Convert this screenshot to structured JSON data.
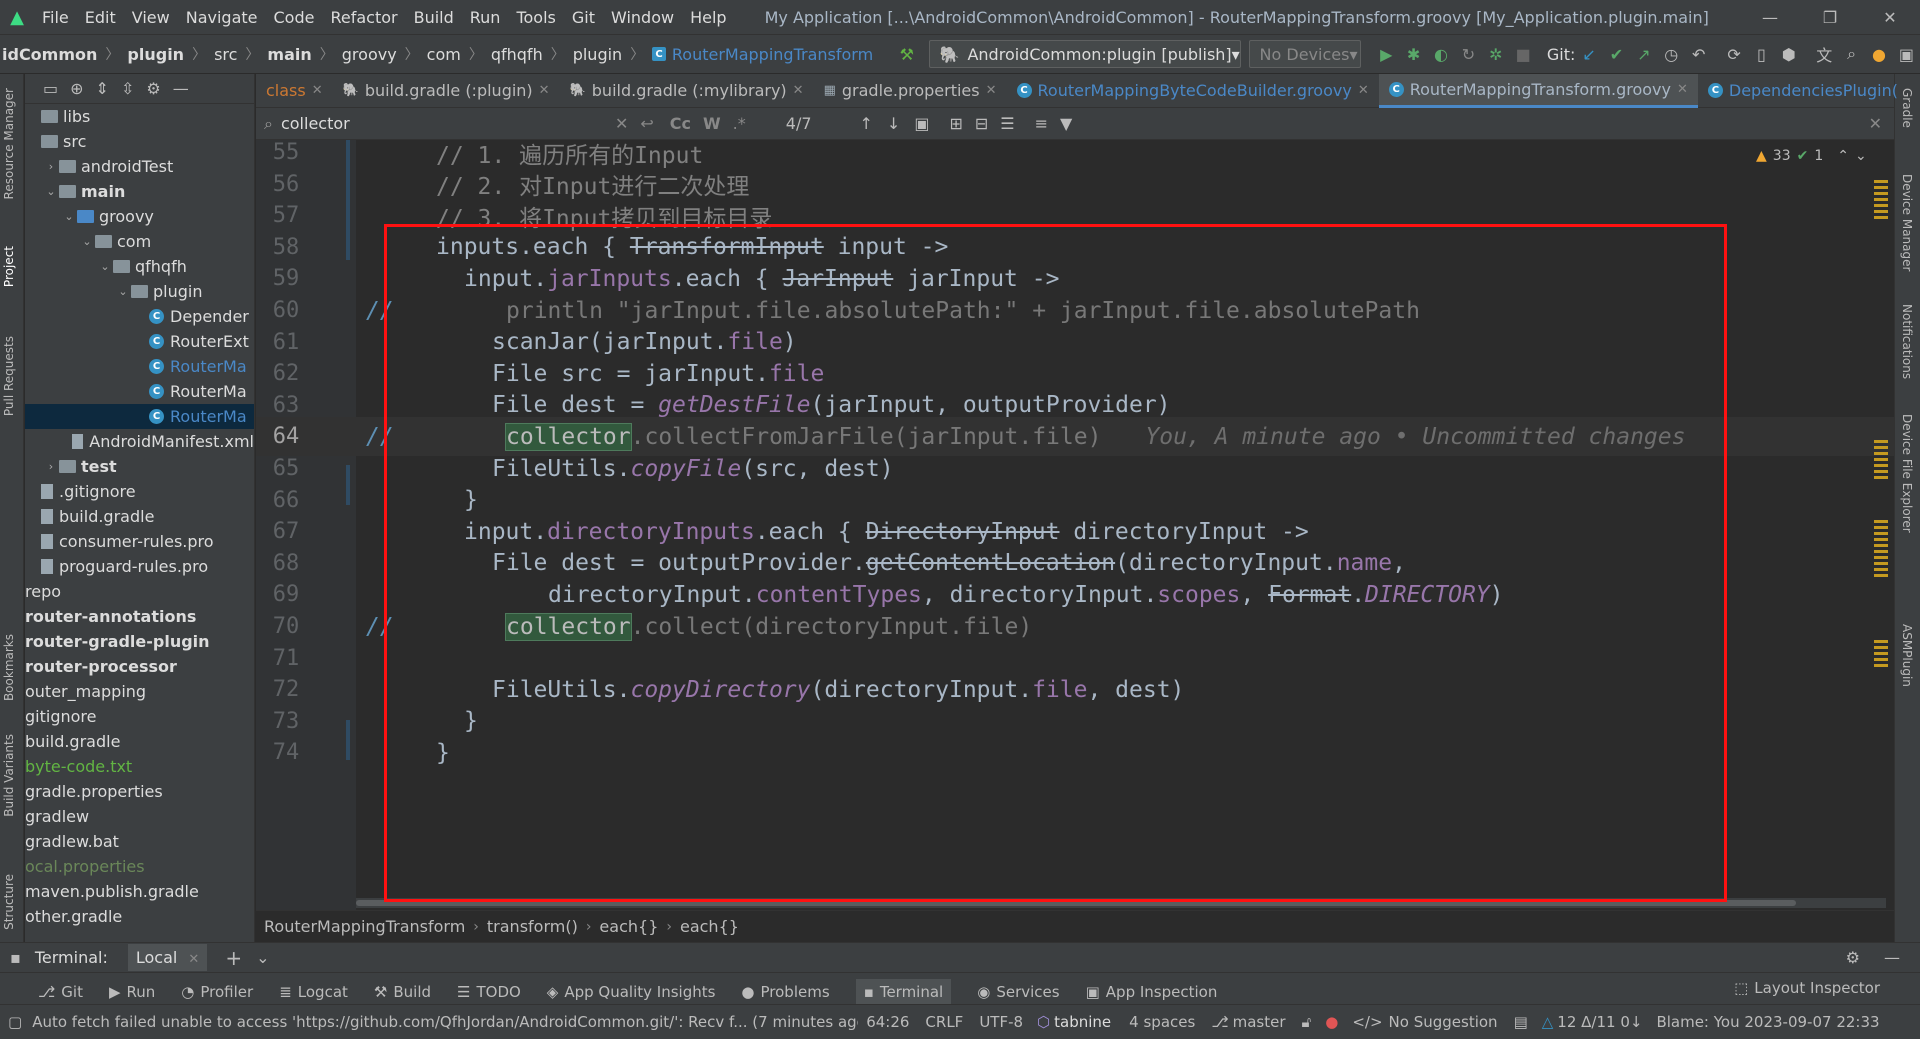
{
  "menubar": {
    "items": [
      "File",
      "Edit",
      "View",
      "Navigate",
      "Code",
      "Refactor",
      "Build",
      "Run",
      "Tools",
      "Git",
      "Window",
      "Help"
    ],
    "title": "My Application [...\\AndroidCommon\\AndroidCommon] - RouterMappingTransform.groovy [My_Application.plugin.main]"
  },
  "navbar": {
    "breadcrumbs": [
      "idCommon",
      "plugin",
      "src",
      "main",
      "groovy",
      "com",
      "qfhqfh",
      "plugin"
    ],
    "current_file": "RouterMappingTransform",
    "run_config": "AndroidCommon:plugin [publish]",
    "device": "No Devices",
    "git_label": "Git:"
  },
  "left_stripe": [
    "Resource Manager",
    "Project",
    "Pull Requests",
    "Bookmarks",
    "Build Variants",
    "Structure"
  ],
  "right_stripe": [
    "Gradle",
    "Device Manager",
    "Notifications",
    "Device File Explorer",
    "ASMPlugin"
  ],
  "project_tree": [
    {
      "label": "libs",
      "indent": 0,
      "kind": "folder"
    },
    {
      "label": "src",
      "indent": 0,
      "kind": "folder"
    },
    {
      "label": "androidTest",
      "indent": 1,
      "kind": "folder",
      "arrow": "›"
    },
    {
      "label": "main",
      "indent": 1,
      "kind": "folder",
      "arrow": "⌄",
      "bold": true
    },
    {
      "label": "groovy",
      "indent": 2,
      "kind": "folder-blue",
      "arrow": "⌄"
    },
    {
      "label": "com",
      "indent": 3,
      "kind": "folder",
      "arrow": "⌄"
    },
    {
      "label": "qfhqfh",
      "indent": 4,
      "kind": "folder",
      "arrow": "⌄"
    },
    {
      "label": "plugin",
      "indent": 5,
      "kind": "folder",
      "arrow": "⌄"
    },
    {
      "label": "Depender",
      "indent": 6,
      "kind": "class"
    },
    {
      "label": "RouterExt",
      "indent": 6,
      "kind": "class"
    },
    {
      "label": "RouterMa",
      "indent": 6,
      "kind": "class",
      "color": "blue"
    },
    {
      "label": "RouterMa",
      "indent": 6,
      "kind": "class"
    },
    {
      "label": "RouterMa",
      "indent": 6,
      "kind": "class",
      "selected": true,
      "color": "blue"
    },
    {
      "label": "AndroidManifest.xml",
      "indent": 2,
      "kind": "file"
    },
    {
      "label": "test",
      "indent": 1,
      "kind": "folder",
      "arrow": "›",
      "bold": true
    },
    {
      "label": ".gitignore",
      "indent": 0,
      "kind": "file"
    },
    {
      "label": "build.gradle",
      "indent": 0,
      "kind": "file"
    },
    {
      "label": "consumer-rules.pro",
      "indent": 0,
      "kind": "file"
    },
    {
      "label": "proguard-rules.pro",
      "indent": 0,
      "kind": "file"
    },
    {
      "label": "repo",
      "indent": -1,
      "kind": "none"
    },
    {
      "label": "router-annotations",
      "indent": -1,
      "kind": "none",
      "bold": true
    },
    {
      "label": "router-gradle-plugin",
      "indent": -1,
      "kind": "none",
      "bold": true
    },
    {
      "label": "router-processor",
      "indent": -1,
      "kind": "none",
      "bold": true
    },
    {
      "label": "outer_mapping",
      "indent": -1,
      "kind": "none"
    },
    {
      "label": "gitignore",
      "indent": -1,
      "kind": "none"
    },
    {
      "label": "build.gradle",
      "indent": -1,
      "kind": "none"
    },
    {
      "label": "byte-code.txt",
      "indent": -1,
      "kind": "none",
      "color": "green"
    },
    {
      "label": "gradle.properties",
      "indent": -1,
      "kind": "none"
    },
    {
      "label": "gradlew",
      "indent": -1,
      "kind": "none"
    },
    {
      "label": "gradlew.bat",
      "indent": -1,
      "kind": "none"
    },
    {
      "label": "ocal.properties",
      "indent": -1,
      "kind": "none",
      "color": "olive"
    },
    {
      "label": "maven.publish.gradle",
      "indent": -1,
      "kind": "none"
    },
    {
      "label": "other.gradle",
      "indent": -1,
      "kind": "none"
    }
  ],
  "tabs": [
    {
      "label": "class",
      "kind": "partial"
    },
    {
      "label": "build.gradle (:plugin)",
      "kind": "gradle"
    },
    {
      "label": "build.gradle (:mylibrary)",
      "kind": "gradle"
    },
    {
      "label": "gradle.properties",
      "kind": "props"
    },
    {
      "label": "RouterMappingByteCodeBuilder.groovy",
      "kind": "groovy"
    },
    {
      "label": "RouterMappingTransform.groovy",
      "kind": "groovy",
      "active": true
    },
    {
      "label": "DependenciesPlugin(",
      "kind": "groovy"
    }
  ],
  "search": {
    "query": "collector",
    "match_count": "4/7",
    "case_label": "Cc",
    "word_label": "W",
    "regex_label": ".*"
  },
  "inspections": {
    "warnings": "33",
    "ok": "1"
  },
  "code_lines": [
    {
      "n": "55",
      "html": "<span class='cmt'>// 1. 遍历所有的Input</span>",
      "indent": 4
    },
    {
      "n": "56",
      "html": "<span class='cmt'>// 2. 对Input进行二次处理</span>",
      "indent": 4
    },
    {
      "n": "57",
      "html": "<span class='cmt'>// 3. 将Input拷贝到目标目录</span>",
      "indent": 4
    },
    {
      "n": "58",
      "html": "inputs.each { <span class='strike'>TransformInput</span> input ->",
      "indent": 4
    },
    {
      "n": "59",
      "html": "input.<span class='fld'>jarInputs</span>.each { <span class='strike'>JarInput</span> jarInput ->",
      "indent": 6
    },
    {
      "n": "60",
      "html": "<span class='faded'>println \"jarInput.file.absolutePath:\" + jarInput.file.absolutePath</span>",
      "indent": 9,
      "slash": true
    },
    {
      "n": "61",
      "html": "scanJar(jarInput.<span class='fld'>file</span>)",
      "indent": 8
    },
    {
      "n": "62",
      "html": "File src = jarInput.<span class='fld'>file</span>",
      "indent": 8
    },
    {
      "n": "63",
      "html": "File dest = <span class='itl'>getDestFile</span>(jarInput, outputProvider)",
      "indent": 8
    },
    {
      "n": "64",
      "html": "<span class='hl'>collector</span><span class='faded'>.collectFromJarFile(jarInput.file)</span><span class='blame'>You, A minute ago • Uncommitted changes</span>",
      "indent": 9,
      "slash": true,
      "current": true
    },
    {
      "n": "65",
      "html": "FileUtils.<span class='itl'>copyFile</span>(src, dest)",
      "indent": 8
    },
    {
      "n": "66",
      "html": "}",
      "indent": 6
    },
    {
      "n": "67",
      "html": "input.<span class='fld'>directoryInputs</span>.each { <span class='strike'>DirectoryInput</span> directoryInput ->",
      "indent": 6
    },
    {
      "n": "68",
      "html": "File dest = outputProvider.<span class='strike'>getContentLocation</span>(directoryInput.<span class='fld'>name</span>,",
      "indent": 8
    },
    {
      "n": "69",
      "html": "directoryInput.<span class='fld'>contentTypes</span>, directoryInput.<span class='fld'>scopes</span>, <span class='strike'>Format</span>.<span class='itl'>DIRECTORY</span>)",
      "indent": 12
    },
    {
      "n": "70",
      "html": "<span class='hl'>collector</span><span class='faded'>.collect(directoryInput.file)</span>",
      "indent": 9,
      "slash": true
    },
    {
      "n": "71",
      "html": "",
      "indent": 0
    },
    {
      "n": "72",
      "html": "FileUtils.<span class='itl'>copyDirectory</span>(directoryInput.<span class='fld'>file</span>, dest)",
      "indent": 8
    },
    {
      "n": "73",
      "html": "}",
      "indent": 6
    },
    {
      "n": "74",
      "html": "}",
      "indent": 4
    }
  ],
  "editor_breadcrumb": [
    "RouterMappingTransform",
    "transform()",
    "each{}",
    "each{}"
  ],
  "terminal": {
    "label": "Terminal:",
    "tab": "Local"
  },
  "tool_windows": [
    "Git",
    "Run",
    "Profiler",
    "Logcat",
    "Build",
    "TODO",
    "App Quality Insights",
    "Problems",
    "Terminal",
    "Services",
    "App Inspection"
  ],
  "layout_inspector": "Layout Inspector",
  "status": {
    "message": "Auto fetch failed unable to access 'https://github.com/QfhJordan/AndroidCommon.git/': Recv f... (7 minutes ago",
    "position": "64:26",
    "line_sep": "CRLF",
    "encoding": "UTF-8",
    "tabnine": "tabnine",
    "indent": "4 spaces",
    "branch": "master",
    "suggestion": "No Suggestion",
    "changes": "12 Δ/11 0↓",
    "blame": "Blame: You 2023-09-07 22:33"
  },
  "colors": {
    "accent": "#4a88c7",
    "highlight_border": "#ff1111"
  }
}
